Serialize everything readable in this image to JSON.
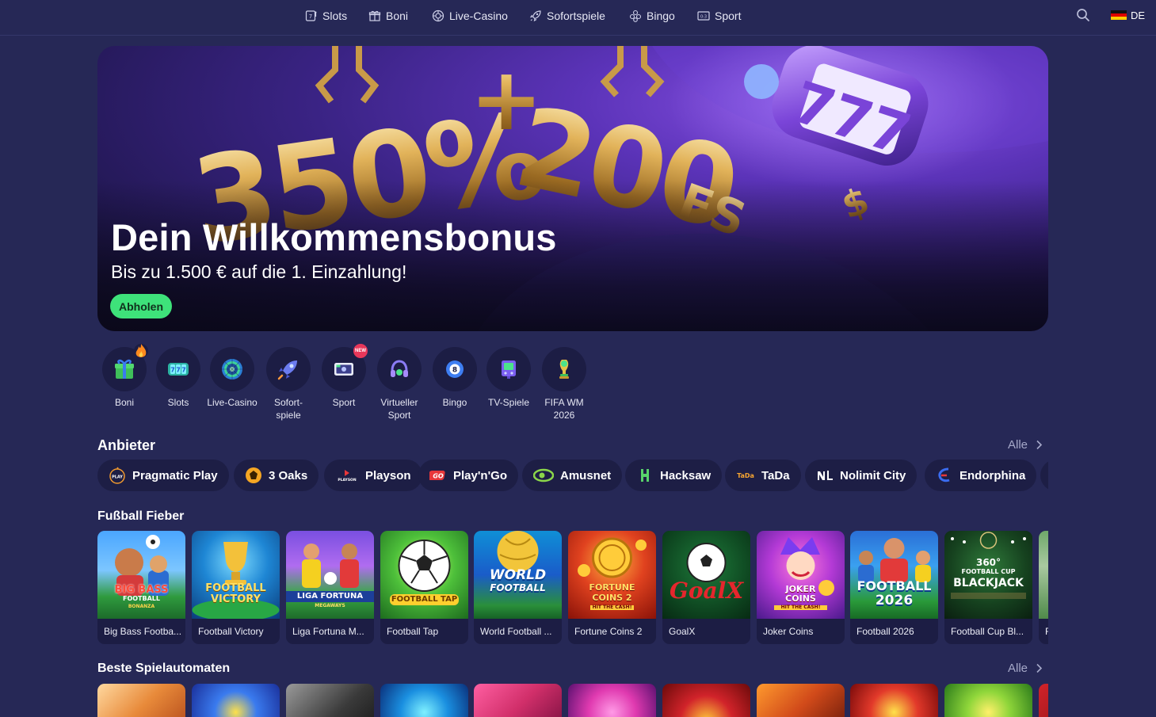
{
  "nav": {
    "items": [
      {
        "label": "Slots",
        "icon": "slot-machine-icon"
      },
      {
        "label": "Boni",
        "icon": "gift-icon"
      },
      {
        "label": "Live-Casino",
        "icon": "roulette-icon"
      },
      {
        "label": "Sofortspiele",
        "icon": "rocket-icon"
      },
      {
        "label": "Bingo",
        "icon": "bingo-balls-icon"
      },
      {
        "label": "Sport",
        "icon": "scoreboard-icon"
      }
    ],
    "language": "DE"
  },
  "hero": {
    "art_text_left": "350%",
    "art_text_plus": "+",
    "art_text_right": "200",
    "art_text_fs": "FS",
    "art_slot_digits": "777",
    "title": "Dein Willkommensbonus",
    "subtitle": "Bis zu 1.500 € auf die 1. Einzahlung!",
    "cta": "Abholen"
  },
  "categories": [
    {
      "label": "Boni",
      "icon": "gift-icon",
      "badge": "fire"
    },
    {
      "label": "Slots",
      "icon": "slot-reels-icon"
    },
    {
      "label": "Live-Casino",
      "icon": "roulette-wheel-icon"
    },
    {
      "label": "Sofort-\nspiele",
      "icon": "rocket-icon"
    },
    {
      "label": "Sport",
      "icon": "tv-icon",
      "badge": "NEW"
    },
    {
      "label": "Virtueller\nSport",
      "icon": "headset-icon"
    },
    {
      "label": "Bingo",
      "icon": "bingo-ball-icon"
    },
    {
      "label": "TV-Spiele",
      "icon": "tv-games-icon"
    },
    {
      "label": "FIFA WM\n2026",
      "icon": "trophy-icon"
    }
  ],
  "providers_section": {
    "title": "Anbieter",
    "all_label": "Alle",
    "items": [
      {
        "label": "Pragmatic Play",
        "color": "#f29a2e"
      },
      {
        "label": "3 Oaks",
        "color": "#f5a623"
      },
      {
        "label": "Playson",
        "color": "#e8373a"
      },
      {
        "label": "Play'n'Go",
        "color": "#e8373a"
      },
      {
        "label": "Amusnet",
        "color": "#8bd64a"
      },
      {
        "label": "Hacksaw",
        "color": "#58d36b"
      },
      {
        "label": "TaDa",
        "color": "#f7a531"
      },
      {
        "label": "Nolimit City",
        "color": "#ffffff"
      },
      {
        "label": "Endorphina",
        "color": "#3a6cf0"
      }
    ],
    "logo_texts": {
      "playson": "PLAYSON",
      "playngo": "GO",
      "tada": "TaDa"
    }
  },
  "football_section": {
    "title": "Fußball Fieber",
    "games": [
      {
        "name": "Big Bass Footba...",
        "art": [
          "BIG BASS",
          "FOOTBALL",
          "BONANZA"
        ]
      },
      {
        "name": "Football Victory",
        "art": [
          "FOOTBALL",
          "VICTORY"
        ]
      },
      {
        "name": "Liga Fortuna M...",
        "art": [
          "LIGA FORTUNA",
          "MEGAWAYS"
        ]
      },
      {
        "name": "Football Tap",
        "art": [
          "FOOTBALL TAP"
        ]
      },
      {
        "name": "World Football ...",
        "art": [
          "WORLD",
          "FOOTBALL"
        ]
      },
      {
        "name": "Fortune Coins 2",
        "art": [
          "FORTUNE",
          "COINS 2",
          "HIT THE CASH!"
        ]
      },
      {
        "name": "GoalX",
        "art": [
          "GoalX"
        ]
      },
      {
        "name": "Joker Coins",
        "art": [
          "JOKER",
          "COINS",
          "HIT THE CASH!"
        ]
      },
      {
        "name": "Football 2026",
        "art": [
          "FOOTBALL",
          "2026"
        ]
      },
      {
        "name": "Football Cup Bl...",
        "art": [
          "360°",
          "FOOTBALL CUP",
          "BLACKJACK"
        ]
      },
      {
        "name": "F",
        "art": [
          ""
        ]
      }
    ]
  },
  "slots_section": {
    "title": "Beste Spielautomaten",
    "all_label": "Alle"
  },
  "colors": {
    "background": "#262856",
    "surface": "#1c1d44",
    "accent_green": "#3ee27a",
    "muted_text": "#a6a9c9"
  }
}
